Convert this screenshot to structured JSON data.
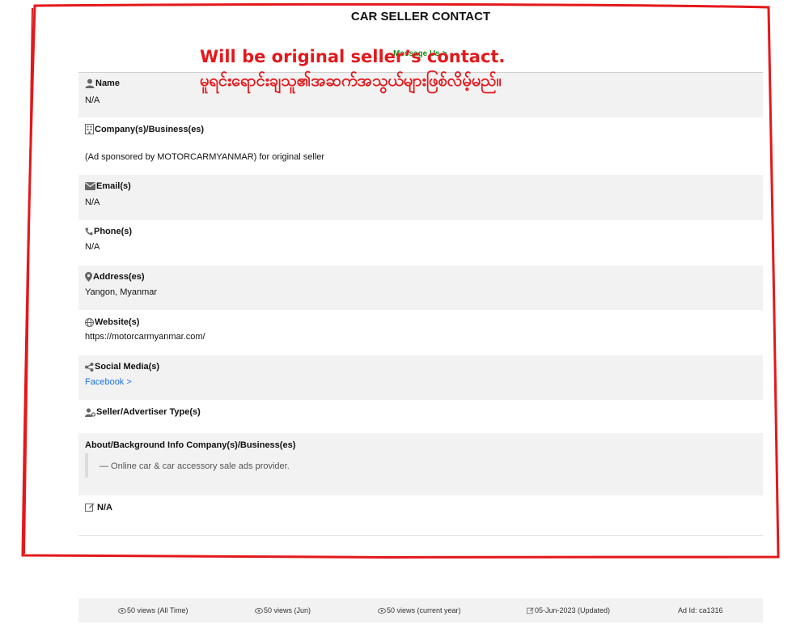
{
  "page": {
    "title": "CAR SELLER CONTACT",
    "message_link": "Message Us >"
  },
  "annotation": {
    "english": "Will be original seller’s contact.",
    "burmese": "မူရင်းရောင်းချသူ၏အဆက်အသွယ်များဖြစ်လိမ့်မည်။",
    "color": "#e4181b"
  },
  "contact": {
    "name": {
      "label": "Name",
      "value": "N/A",
      "icon": "person-icon"
    },
    "company": {
      "label": "Company(s)/Business(es)",
      "value": "(Ad sponsored by MOTORCARMYANMAR) for original seller",
      "icon": "building-icon"
    },
    "email": {
      "label": "Email(s)",
      "value": "N/A",
      "icon": "envelope-icon"
    },
    "phone": {
      "label": "Phone(s)",
      "value": "N/A",
      "icon": "phone-icon"
    },
    "address": {
      "label": "Address(es)",
      "value": "Yangon, Myanmar",
      "icon": "map-pin-icon"
    },
    "website": {
      "label": "Website(s)",
      "value": "https://motorcarmyanmar.com/",
      "icon": "globe-icon"
    },
    "social": {
      "label": "Social Media(s)",
      "value": "Facebook >",
      "icon": "share-icon"
    },
    "seller_type": {
      "label": "Seller/Advertiser Type(s)",
      "icon": "user-gear-icon"
    },
    "about": {
      "label": "About/Background Info Company(s)/Business(es)",
      "quote": "— Online car & car accessory sale ads provider."
    },
    "note": {
      "label": "N/A",
      "icon": "edit-icon"
    }
  },
  "stats": {
    "all_time": "50 views (All Time)",
    "month": "50 views (Jun)",
    "year": "50 views (current year)",
    "updated": "05-Jun-2023 (Updated)",
    "ad_id": "Ad Id: ca1316"
  },
  "colors": {
    "link": "#1a73e8",
    "message_link": "#1a8a1a",
    "shaded_row": "#f2f2f2"
  }
}
